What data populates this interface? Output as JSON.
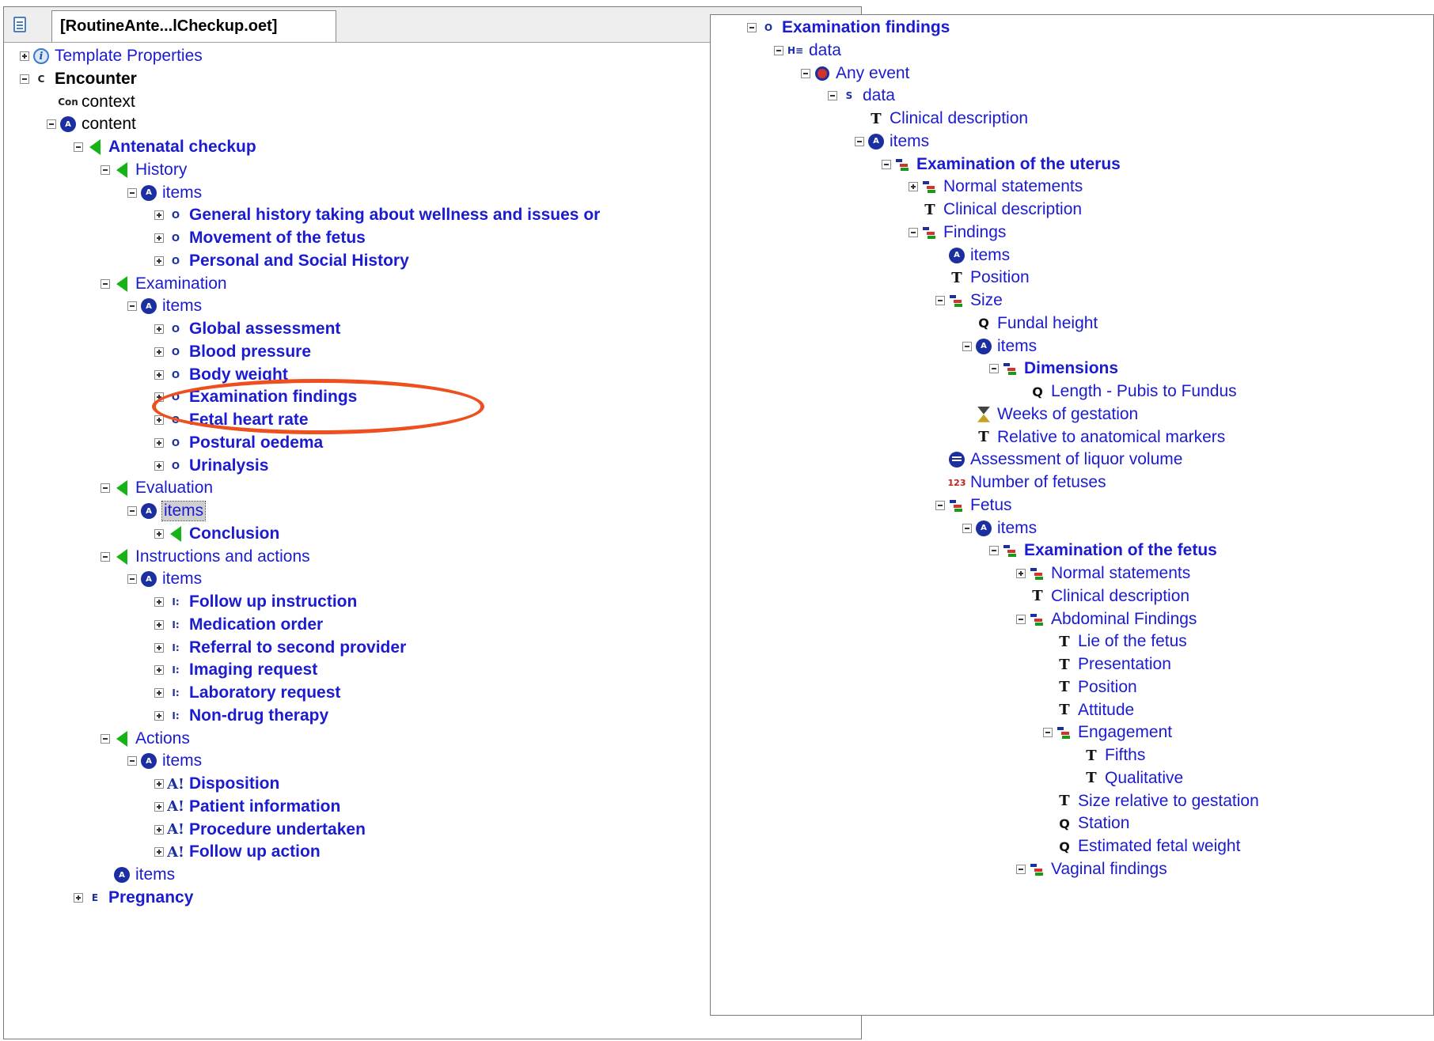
{
  "left_panel": {
    "tab_title": "[RoutineAnte...lCheckup.oet]",
    "rows": [
      {
        "label": "Template Properties",
        "icon": "info-icon",
        "toggle": "plus",
        "style": "normal",
        "level": 0
      },
      {
        "label": "Encounter",
        "icon": "composition-icon",
        "icon_text": "C",
        "toggle": "minus",
        "style": "bold-black",
        "level": 0
      },
      {
        "label": "context",
        "icon": "context-icon",
        "icon_text": "Con",
        "toggle": "none",
        "style": "black",
        "level": 1
      },
      {
        "label": "content",
        "icon": "content-icon",
        "icon_text": "A",
        "toggle": "minus",
        "style": "black",
        "level": 1
      },
      {
        "label": "Antenatal checkup",
        "icon": "section-icon",
        "toggle": "minus",
        "style": "bold",
        "level": 2
      },
      {
        "label": "History",
        "icon": "section-icon",
        "toggle": "minus",
        "style": "normal",
        "level": 3
      },
      {
        "label": "items",
        "icon": "items-icon",
        "icon_text": "A",
        "toggle": "minus",
        "style": "normal",
        "level": 4
      },
      {
        "label": "General history taking about wellness and issues or",
        "icon": "observation-icon",
        "icon_text": "O",
        "toggle": "plus",
        "style": "bold",
        "level": 5
      },
      {
        "label": "Movement of the fetus",
        "icon": "observation-icon",
        "icon_text": "O",
        "toggle": "plus",
        "style": "bold",
        "level": 5
      },
      {
        "label": "Personal and Social History",
        "icon": "observation-icon",
        "icon_text": "O",
        "toggle": "plus",
        "style": "bold",
        "level": 5
      },
      {
        "label": "Examination",
        "icon": "section-icon",
        "toggle": "minus",
        "style": "normal",
        "level": 3
      },
      {
        "label": "items",
        "icon": "items-icon",
        "icon_text": "A",
        "toggle": "minus",
        "style": "normal",
        "level": 4
      },
      {
        "label": "Global assessment",
        "icon": "observation-icon",
        "icon_text": "O",
        "toggle": "plus",
        "style": "bold",
        "level": 5
      },
      {
        "label": "Blood pressure",
        "icon": "observation-icon",
        "icon_text": "O",
        "toggle": "plus",
        "style": "bold",
        "level": 5
      },
      {
        "label": "Body weight",
        "icon": "observation-icon",
        "icon_text": "O",
        "toggle": "plus",
        "style": "bold",
        "level": 5
      },
      {
        "label": "Examination findings",
        "icon": "observation-icon",
        "icon_text": "O",
        "toggle": "plus",
        "style": "bold",
        "level": 5
      },
      {
        "label": "Fetal heart rate",
        "icon": "observation-icon",
        "icon_text": "O",
        "toggle": "plus",
        "style": "bold",
        "level": 5
      },
      {
        "label": "Postural oedema",
        "icon": "observation-icon",
        "icon_text": "O",
        "toggle": "plus",
        "style": "bold",
        "level": 5
      },
      {
        "label": "Urinalysis",
        "icon": "observation-icon",
        "icon_text": "O",
        "toggle": "plus",
        "style": "bold",
        "level": 5
      },
      {
        "label": "Evaluation",
        "icon": "section-icon",
        "toggle": "minus",
        "style": "normal",
        "level": 3
      },
      {
        "label": "items",
        "icon": "items-icon",
        "icon_text": "A",
        "toggle": "minus",
        "style": "selected",
        "level": 4
      },
      {
        "label": "Conclusion",
        "icon": "section-icon",
        "toggle": "plus",
        "style": "bold",
        "level": 5
      },
      {
        "label": "Instructions and actions",
        "icon": "section-icon",
        "toggle": "minus",
        "style": "normal",
        "level": 3
      },
      {
        "label": "items",
        "icon": "items-icon",
        "icon_text": "A",
        "toggle": "minus",
        "style": "normal",
        "level": 4
      },
      {
        "label": "Follow up instruction",
        "icon": "instruction-icon",
        "icon_text": "I:",
        "toggle": "plus",
        "style": "bold",
        "level": 5
      },
      {
        "label": "Medication order",
        "icon": "instruction-icon",
        "icon_text": "I:",
        "toggle": "plus",
        "style": "bold",
        "level": 5
      },
      {
        "label": "Referral to second provider",
        "icon": "instruction-icon",
        "icon_text": "I:",
        "toggle": "plus",
        "style": "bold",
        "level": 5
      },
      {
        "label": "Imaging request",
        "icon": "instruction-icon",
        "icon_text": "I:",
        "toggle": "plus",
        "style": "bold",
        "level": 5
      },
      {
        "label": "Laboratory request",
        "icon": "instruction-icon",
        "icon_text": "I:",
        "toggle": "plus",
        "style": "bold",
        "level": 5
      },
      {
        "label": "Non-drug therapy",
        "icon": "instruction-icon",
        "icon_text": "I:",
        "toggle": "plus",
        "style": "bold",
        "level": 5
      },
      {
        "label": "Actions",
        "icon": "section-icon",
        "toggle": "minus",
        "style": "normal",
        "level": 3
      },
      {
        "label": "items",
        "icon": "items-icon",
        "icon_text": "A",
        "toggle": "minus",
        "style": "normal",
        "level": 4
      },
      {
        "label": "Disposition",
        "icon": "action-icon",
        "icon_text": "A!",
        "toggle": "plus",
        "style": "bold",
        "level": 5
      },
      {
        "label": "Patient information",
        "icon": "action-icon",
        "icon_text": "A!",
        "toggle": "plus",
        "style": "bold",
        "level": 5
      },
      {
        "label": "Procedure undertaken",
        "icon": "action-icon",
        "icon_text": "A!",
        "toggle": "plus",
        "style": "bold",
        "level": 5
      },
      {
        "label": "Follow up action",
        "icon": "action-icon",
        "icon_text": "A!",
        "toggle": "plus",
        "style": "bold",
        "level": 5
      },
      {
        "label": "items",
        "icon": "items-icon",
        "icon_text": "A",
        "toggle": "none",
        "style": "normal",
        "level": 3
      },
      {
        "label": "Pregnancy",
        "icon": "evaluation-icon",
        "icon_text": "E",
        "toggle": "plus",
        "style": "bold",
        "level": 2
      }
    ]
  },
  "right_panel": {
    "rows": [
      {
        "label": "Examination findings",
        "icon": "observation-icon",
        "icon_text": "O",
        "toggle": "minus",
        "style": "bold",
        "level": 0
      },
      {
        "label": "data",
        "icon": "history-icon",
        "icon_text": "H≡",
        "toggle": "minus",
        "style": "normal",
        "level": 1
      },
      {
        "label": "Any event",
        "icon": "event-icon",
        "toggle": "minus",
        "style": "normal",
        "level": 2
      },
      {
        "label": "data",
        "icon": "structure-icon",
        "icon_text": "S",
        "toggle": "minus",
        "style": "normal",
        "level": 3
      },
      {
        "label": "Clinical description",
        "icon": "text-icon",
        "icon_text": "T",
        "toggle": "none",
        "style": "normal",
        "level": 4
      },
      {
        "label": "items",
        "icon": "items-icon",
        "icon_text": "A",
        "toggle": "minus",
        "style": "normal",
        "level": 4
      },
      {
        "label": "Examination of the uterus",
        "icon": "cluster-icon",
        "toggle": "minus",
        "style": "bold",
        "level": 5
      },
      {
        "label": "Normal statements",
        "icon": "cluster-icon",
        "toggle": "plus",
        "style": "normal",
        "level": 6
      },
      {
        "label": "Clinical description",
        "icon": "text-icon",
        "icon_text": "T",
        "toggle": "none",
        "style": "normal",
        "level": 6
      },
      {
        "label": "Findings",
        "icon": "cluster-icon",
        "toggle": "minus",
        "style": "normal",
        "level": 6
      },
      {
        "label": "items",
        "icon": "items-icon",
        "icon_text": "A",
        "toggle": "none",
        "style": "normal",
        "level": 7
      },
      {
        "label": "Position",
        "icon": "text-icon",
        "icon_text": "T",
        "toggle": "none",
        "style": "normal",
        "level": 7
      },
      {
        "label": "Size",
        "icon": "cluster-icon",
        "toggle": "minus",
        "style": "normal",
        "level": 7
      },
      {
        "label": "Fundal height",
        "icon": "quantity-icon",
        "icon_text": "Q",
        "toggle": "none",
        "style": "normal",
        "level": 8
      },
      {
        "label": "items",
        "icon": "items-icon",
        "icon_text": "A",
        "toggle": "minus",
        "style": "normal",
        "level": 8
      },
      {
        "label": "Dimensions",
        "icon": "cluster-icon",
        "toggle": "minus",
        "style": "bold",
        "level": 9
      },
      {
        "label": "Length - Pubis to Fundus",
        "icon": "quantity-icon",
        "icon_text": "Q",
        "toggle": "none",
        "style": "normal",
        "level": 10
      },
      {
        "label": "Weeks of gestation",
        "icon": "duration-icon",
        "toggle": "none",
        "style": "normal",
        "level": 8
      },
      {
        "label": "Relative to anatomical markers",
        "icon": "text-icon",
        "icon_text": "T",
        "toggle": "none",
        "style": "normal",
        "level": 8
      },
      {
        "label": "Assessment of liquor volume",
        "icon": "ordinal-icon",
        "toggle": "none",
        "style": "normal",
        "level": 7
      },
      {
        "label": "Number of fetuses",
        "icon": "count-icon",
        "icon_text": "123",
        "toggle": "none",
        "style": "normal",
        "level": 7
      },
      {
        "label": "Fetus",
        "icon": "cluster-icon",
        "toggle": "minus",
        "style": "normal",
        "level": 7
      },
      {
        "label": "items",
        "icon": "items-icon",
        "icon_text": "A",
        "toggle": "minus",
        "style": "normal",
        "level": 8
      },
      {
        "label": "Examination of the fetus",
        "icon": "cluster-icon",
        "toggle": "minus",
        "style": "bold",
        "level": 9
      },
      {
        "label": "Normal statements",
        "icon": "cluster-icon",
        "toggle": "plus",
        "style": "normal",
        "level": 10
      },
      {
        "label": "Clinical description",
        "icon": "text-icon",
        "icon_text": "T",
        "toggle": "none",
        "style": "normal",
        "level": 10
      },
      {
        "label": "Abdominal Findings",
        "icon": "cluster-icon",
        "toggle": "minus",
        "style": "normal",
        "level": 10
      },
      {
        "label": "Lie of the fetus",
        "icon": "text-icon",
        "icon_text": "T",
        "toggle": "none",
        "style": "normal",
        "level": 11
      },
      {
        "label": "Presentation",
        "icon": "text-icon",
        "icon_text": "T",
        "toggle": "none",
        "style": "normal",
        "level": 11
      },
      {
        "label": "Position",
        "icon": "text-icon",
        "icon_text": "T",
        "toggle": "none",
        "style": "normal",
        "level": 11
      },
      {
        "label": "Attitude",
        "icon": "text-icon",
        "icon_text": "T",
        "toggle": "none",
        "style": "normal",
        "level": 11
      },
      {
        "label": "Engagement",
        "icon": "cluster-icon",
        "toggle": "minus",
        "style": "normal",
        "level": 11
      },
      {
        "label": "Fifths",
        "icon": "text-icon",
        "icon_text": "T",
        "toggle": "none",
        "style": "normal",
        "level": 12
      },
      {
        "label": "Qualitative",
        "icon": "text-icon",
        "icon_text": "T",
        "toggle": "none",
        "style": "normal",
        "level": 12
      },
      {
        "label": "Size relative to gestation",
        "icon": "text-icon",
        "icon_text": "T",
        "toggle": "none",
        "style": "normal",
        "level": 11
      },
      {
        "label": "Station",
        "icon": "quantity-icon",
        "icon_text": "Q",
        "toggle": "none",
        "style": "normal",
        "level": 11
      },
      {
        "label": "Estimated fetal weight",
        "icon": "quantity-icon",
        "icon_text": "Q",
        "toggle": "none",
        "style": "normal",
        "level": 11
      },
      {
        "label": "Vaginal findings",
        "icon": "cluster-icon",
        "toggle": "minus",
        "style": "normal",
        "level": 10
      }
    ]
  },
  "highlight": {
    "target": "Examination findings",
    "color": "#ee4f1e"
  },
  "colors": {
    "link_blue": "#1b1bcf",
    "section_green": "#16b316",
    "icon_navy": "#1c2fa0"
  }
}
